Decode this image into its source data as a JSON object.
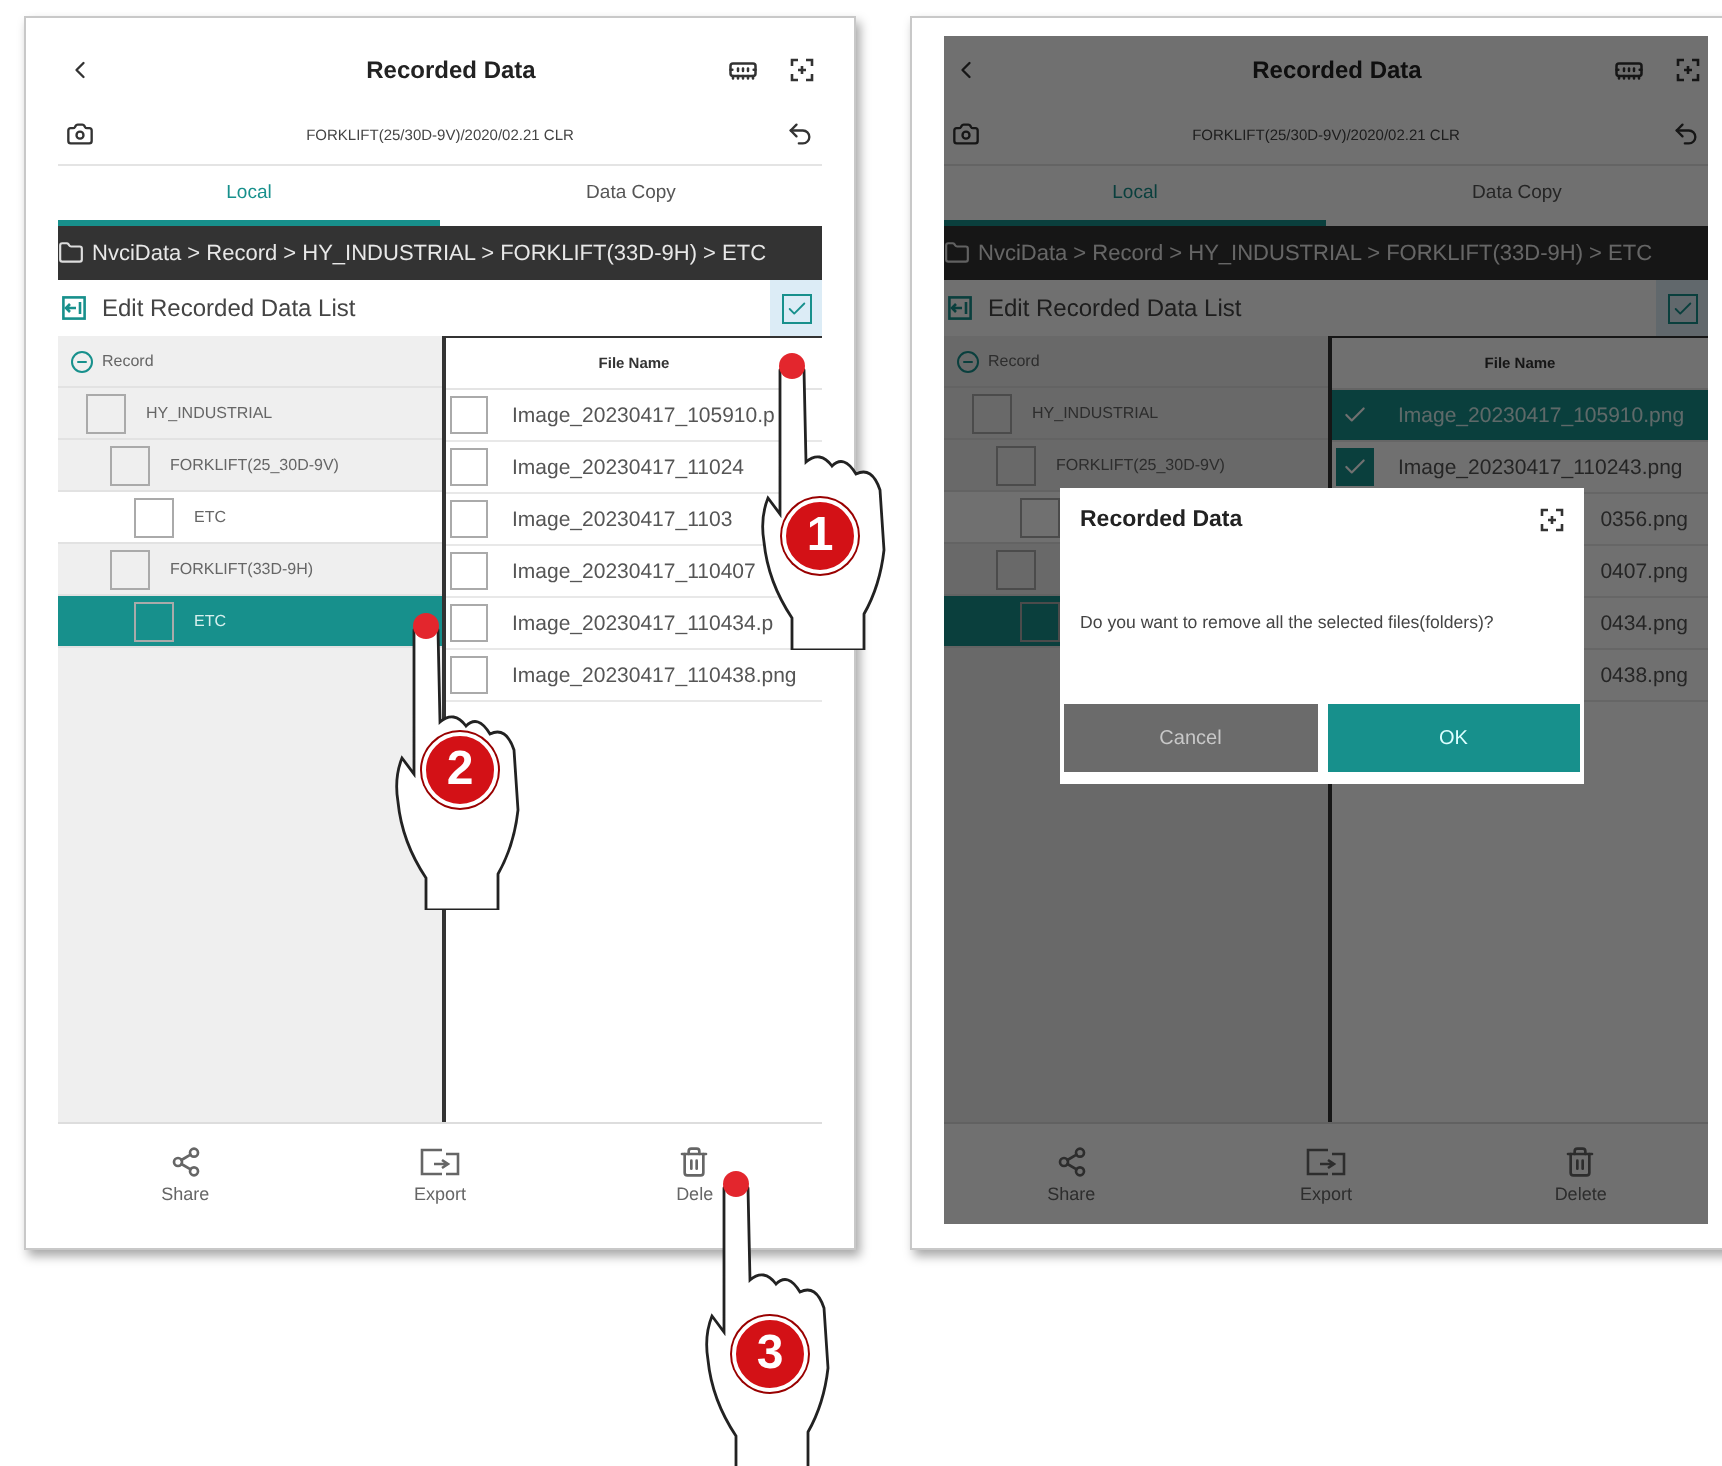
{
  "screens": [
    {
      "title": "Recorded Data",
      "subtitle": "FORKLIFT(25/30D-9V)/2020/02.21 CLR",
      "dimmed": false,
      "tabs": [
        {
          "label": "Local",
          "selected": true
        },
        {
          "label": "Data Copy",
          "selected": false
        }
      ],
      "breadcrumb": "NvciData > Record > HY_INDUSTRIAL > FORKLIFT(33D-9H) > ETC",
      "edit_label": "Edit Recorded Data List",
      "select_all_checked": true,
      "tree": {
        "label": "Record",
        "expanded": true,
        "children": [
          {
            "label": "HY_INDUSTRIAL",
            "checked": false,
            "selected": false,
            "children": [
              {
                "label": "FORKLIFT(25_30D-9V)",
                "checked": false,
                "selected": false,
                "children": [
                  {
                    "label": "ETC",
                    "checked": false,
                    "selected": false
                  }
                ]
              },
              {
                "label": "FORKLIFT(33D-9H)",
                "checked": false,
                "selected": false,
                "children": [
                  {
                    "label": "ETC",
                    "checked": false,
                    "selected": true
                  }
                ]
              }
            ]
          }
        ]
      },
      "file_header": "File Name",
      "files": [
        {
          "kind": "full",
          "name": "Image_20230417_105910.p",
          "checked": false,
          "selected": false
        },
        {
          "kind": "full",
          "name": "Image_20230417_11024",
          "checked": false,
          "selected": false
        },
        {
          "kind": "full",
          "name": "Image_20230417_1103",
          "checked": false,
          "selected": false
        },
        {
          "kind": "full",
          "name": "Image_20230417_110407",
          "checked": false,
          "selected": false
        },
        {
          "kind": "full",
          "name": "Image_20230417_110434.p",
          "checked": false,
          "selected": false
        },
        {
          "kind": "full",
          "name": "Image_20230417_110438.png",
          "checked": false,
          "selected": false
        }
      ],
      "toolbar": [
        {
          "kind": "share",
          "label": "Share"
        },
        {
          "kind": "export",
          "label": "Export"
        },
        {
          "kind": "delete",
          "label": "Dele"
        }
      ]
    },
    {
      "title": "Recorded Data",
      "subtitle": "FORKLIFT(25/30D-9V)/2020/02.21 CLR",
      "dimmed": true,
      "tabs": [
        {
          "label": "Local",
          "selected": true
        },
        {
          "label": "Data Copy",
          "selected": false
        }
      ],
      "breadcrumb": "NvciData > Record > HY_INDUSTRIAL > FORKLIFT(33D-9H) > ETC",
      "edit_label": "Edit Recorded Data List",
      "select_all_checked": true,
      "tree": {
        "label": "Record",
        "expanded": true,
        "children": [
          {
            "label": "HY_INDUSTRIAL",
            "checked": false,
            "selected": false,
            "children": [
              {
                "label": "FORKLIFT(25_30D-9V)",
                "checked": false,
                "selected": false,
                "children": [
                  {
                    "checked": false,
                    "selected": false
                  }
                ]
              },
              {
                "checked": false,
                "selected": false,
                "children": [
                  {
                    "checked": false,
                    "selected": true
                  }
                ]
              }
            ]
          }
        ]
      },
      "file_header": "File Name",
      "files": [
        {
          "kind": "full",
          "name": "Image_20230417_105910.png",
          "checked": true,
          "selected": true
        },
        {
          "kind": "full",
          "name": "Image_20230417_110243.png",
          "checked": true,
          "selected": false
        },
        {
          "kind": "tail",
          "name": "0356.png",
          "selected": false
        },
        {
          "kind": "tail",
          "name": "0407.png",
          "selected": false
        },
        {
          "kind": "tail",
          "name": "0434.png",
          "selected": false
        },
        {
          "kind": "tail",
          "name": "0438.png",
          "selected": false
        }
      ],
      "toolbar": [
        {
          "kind": "share",
          "label": "Share"
        },
        {
          "kind": "export",
          "label": "Export"
        },
        {
          "kind": "delete",
          "label": "Delete"
        }
      ],
      "dialog": {
        "title": "Recorded Data",
        "message": "Do you want to remove all the selected files(folders)?",
        "buttons": [
          {
            "kind": "cancel",
            "label": "Cancel"
          },
          {
            "kind": "ok",
            "label": "OK"
          }
        ]
      }
    }
  ],
  "steps": [
    {
      "number": "1"
    },
    {
      "number": "2"
    },
    {
      "number": "3"
    }
  ]
}
